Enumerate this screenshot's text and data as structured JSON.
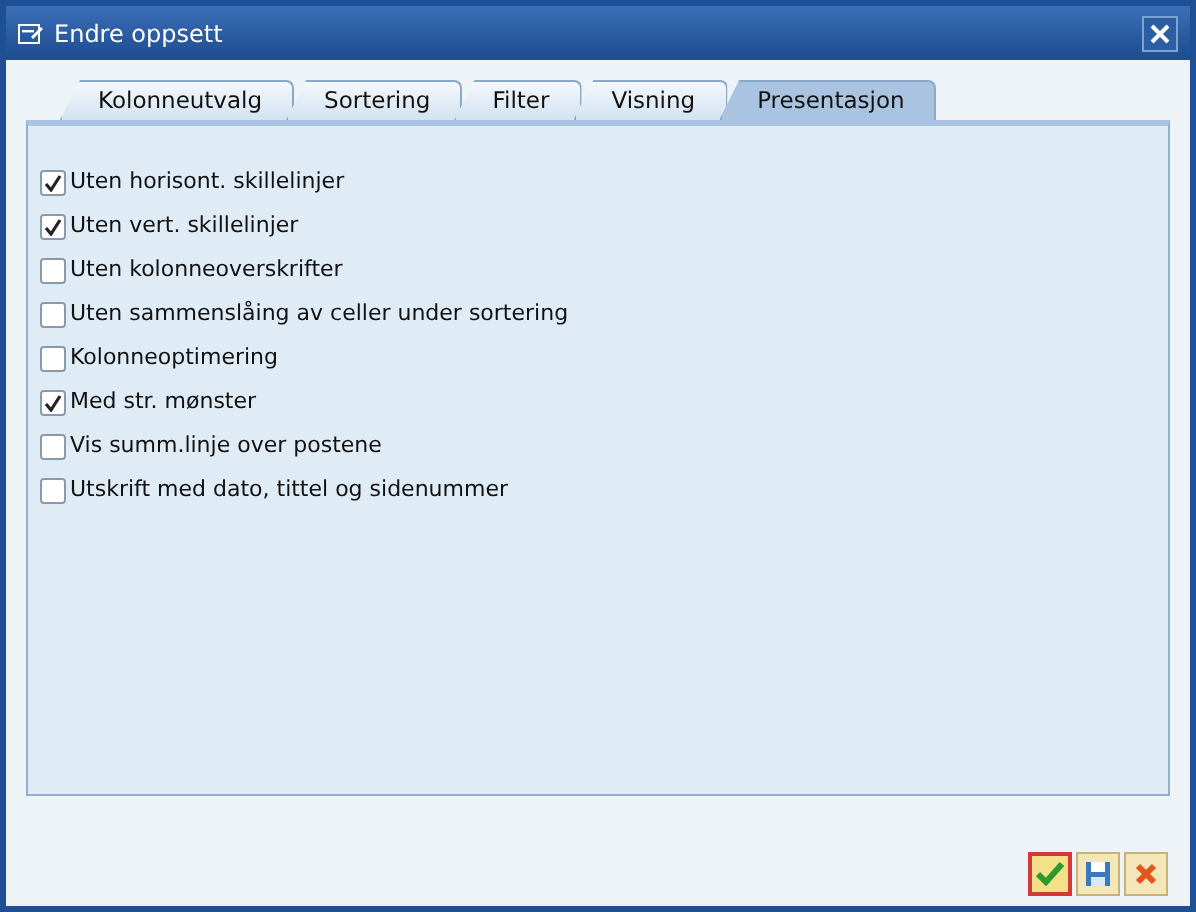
{
  "window": {
    "title": "Endre oppsett"
  },
  "tabs": [
    {
      "label": "Kolonneutvalg",
      "selected": false
    },
    {
      "label": "Sortering",
      "selected": false
    },
    {
      "label": "Filter",
      "selected": false
    },
    {
      "label": "Visning",
      "selected": false
    },
    {
      "label": "Presentasjon",
      "selected": true
    }
  ],
  "options": [
    {
      "label": "Uten horisont. skillelinjer",
      "checked": true
    },
    {
      "label": "Uten vert. skillelinjer",
      "checked": true
    },
    {
      "label": "Uten kolonneoverskrifter",
      "checked": false
    },
    {
      "label": "Uten sammenslåing av celler under sortering",
      "checked": false
    },
    {
      "label": "Kolonneoptimering",
      "checked": false
    },
    {
      "label": "Med str. mønster",
      "checked": true
    },
    {
      "label": "Vis summ.linje over postene",
      "checked": false
    },
    {
      "label": "Utskrift med dato, tittel og sidenummer",
      "checked": false
    }
  ]
}
